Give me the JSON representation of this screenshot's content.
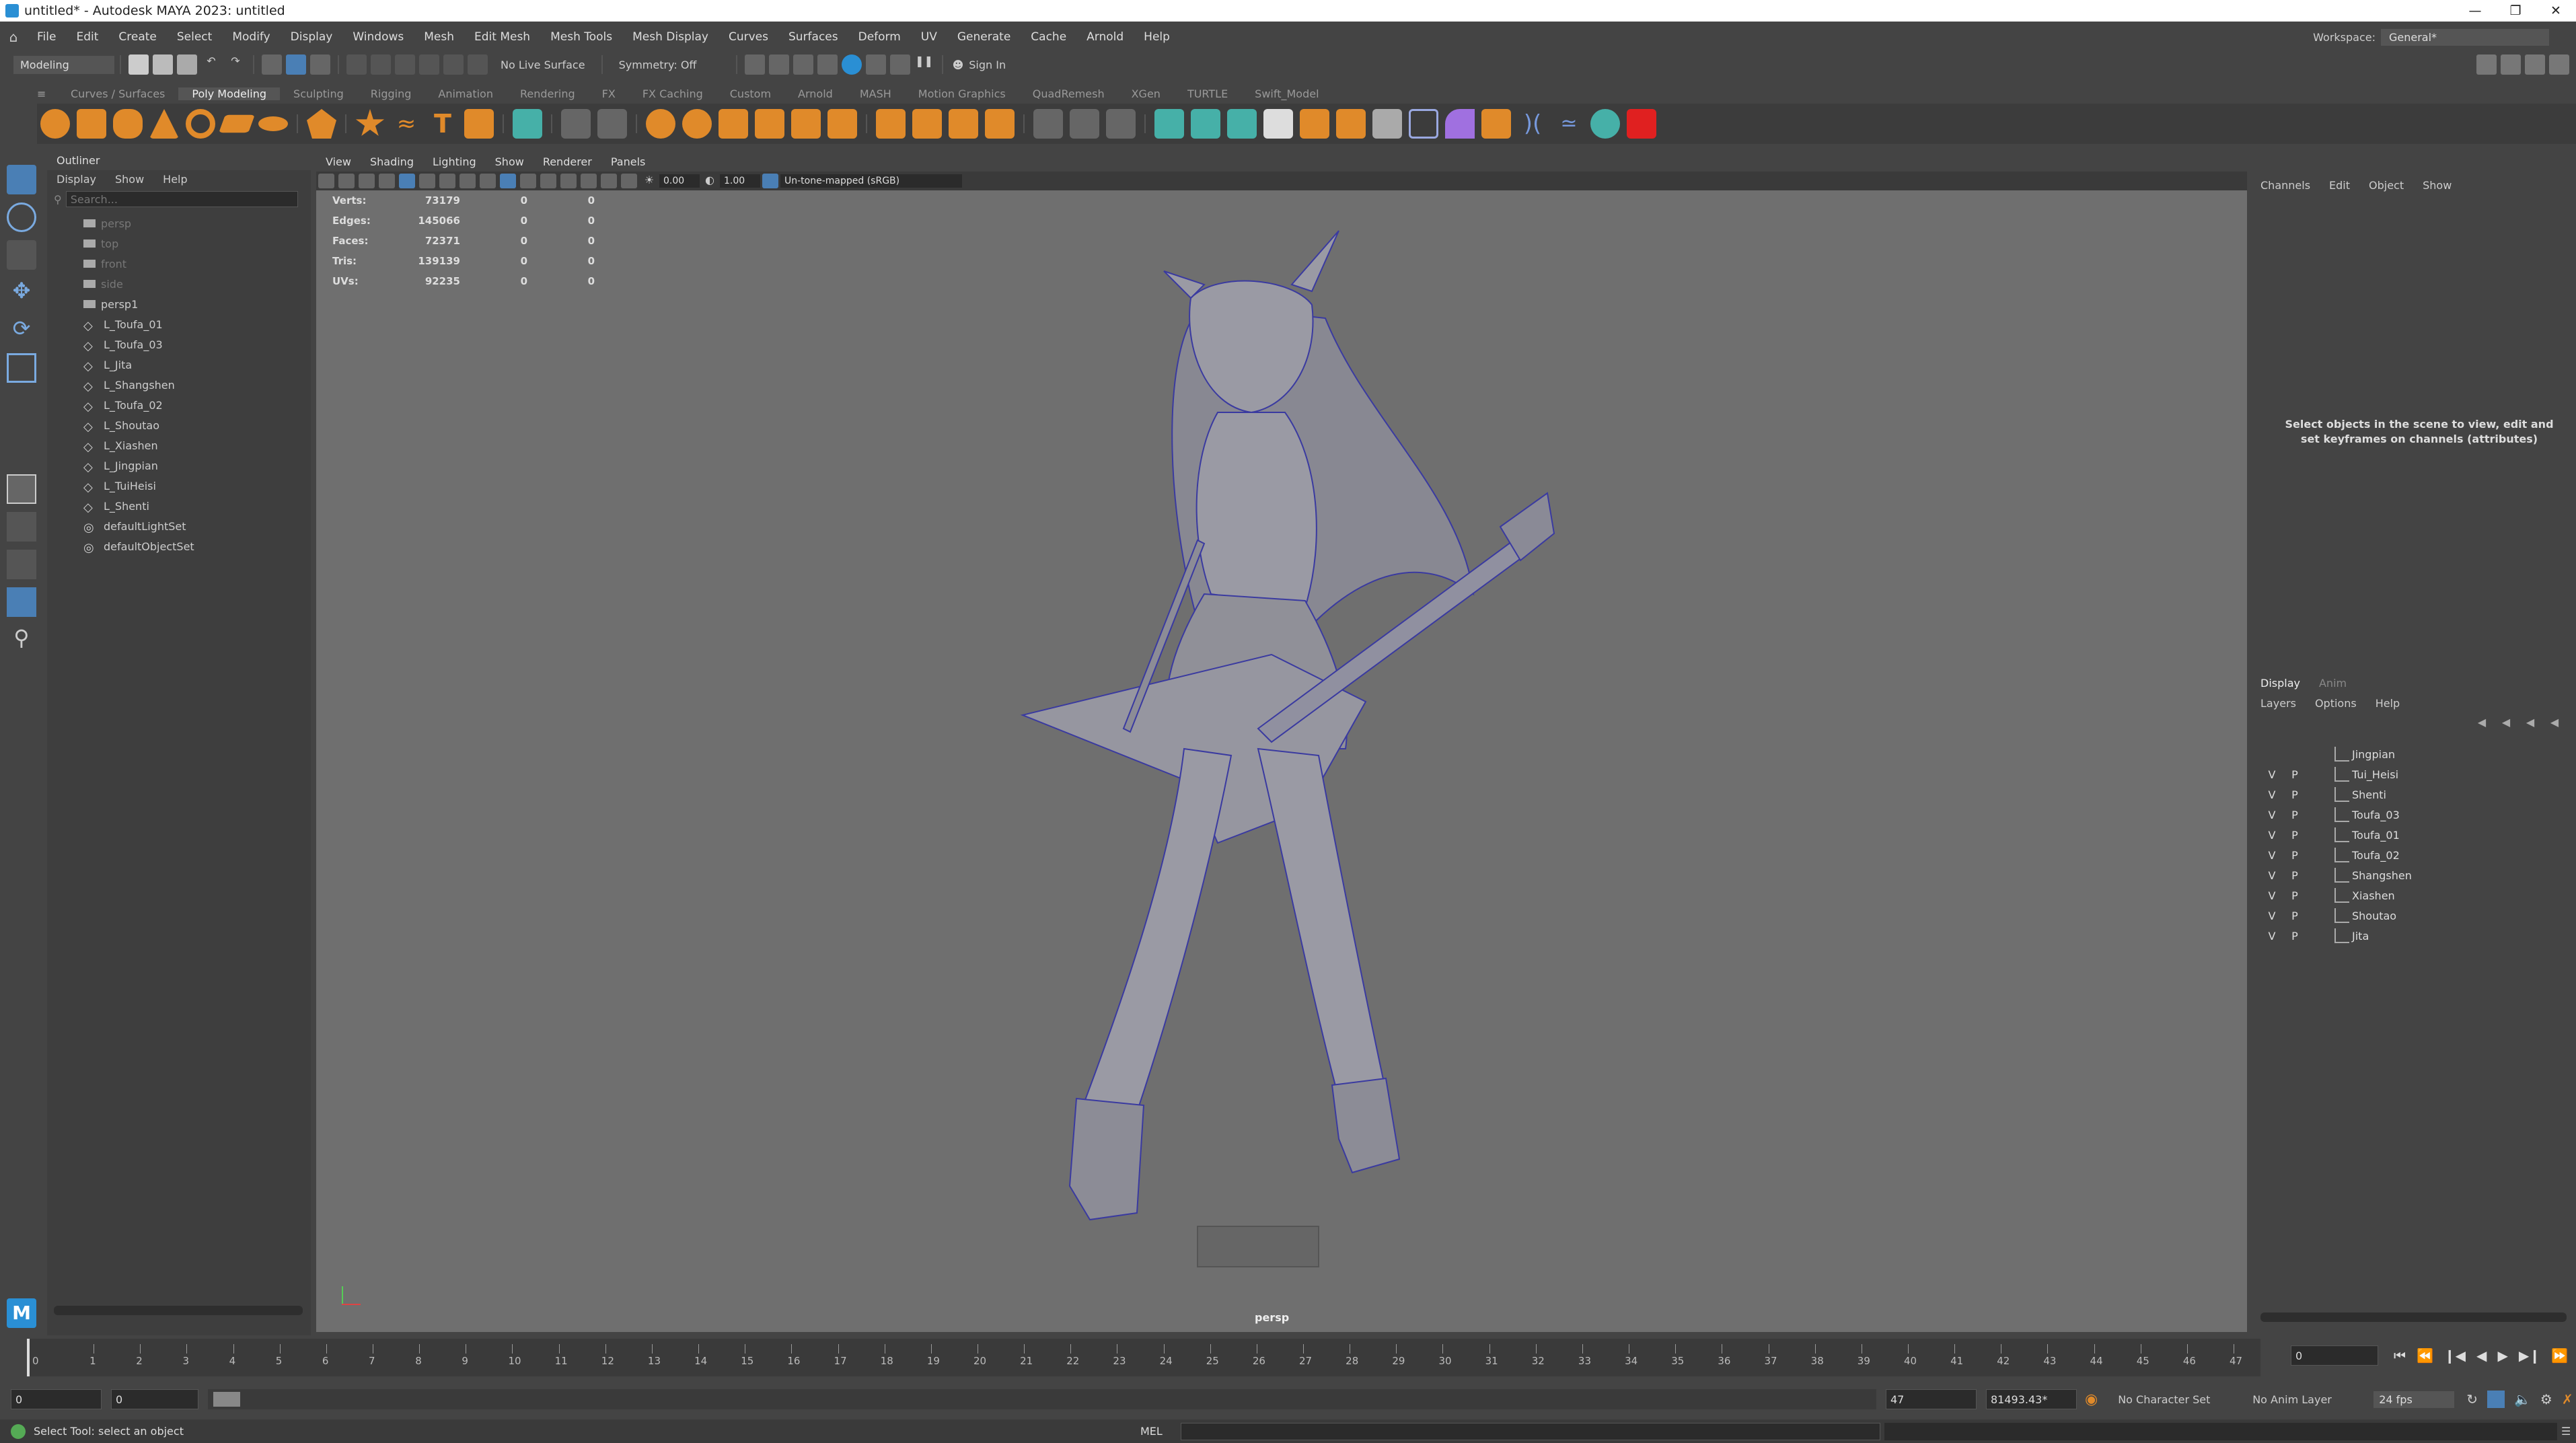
{
  "window": {
    "title": "untitled* - Autodesk MAYA 2023: untitled"
  },
  "menu": [
    "File",
    "Edit",
    "Create",
    "Select",
    "Modify",
    "Display",
    "Windows",
    "Mesh",
    "Edit Mesh",
    "Mesh Tools",
    "Mesh Display",
    "Curves",
    "Surfaces",
    "Deform",
    "UV",
    "Generate",
    "Cache",
    "Arnold",
    "Help"
  ],
  "workspace": {
    "label": "Workspace:",
    "value": "General*"
  },
  "statusline": {
    "mode": "Modeling",
    "live_surface": "No Live Surface",
    "symmetry": "Symmetry: Off",
    "sign_in": "Sign In"
  },
  "shelf_tabs": [
    "Curves / Surfaces",
    "Poly Modeling",
    "Sculpting",
    "Rigging",
    "Animation",
    "Rendering",
    "FX",
    "FX Caching",
    "Custom",
    "Arnold",
    "MASH",
    "Motion Graphics",
    "QuadRemesh",
    "XGen",
    "TURTLE",
    "Swift_Model"
  ],
  "shelf_active": "Poly Modeling",
  "shelf_colors": {
    "orange": "#e08a2a",
    "teal": "#46b0a8",
    "red": "#e02020"
  },
  "outliner": {
    "title": "Outliner",
    "menu": [
      "Display",
      "Show",
      "Help"
    ],
    "search_placeholder": "Search...",
    "items": [
      {
        "name": "persp",
        "type": "camera",
        "dim": true
      },
      {
        "name": "top",
        "type": "camera",
        "dim": true
      },
      {
        "name": "front",
        "type": "camera",
        "dim": true
      },
      {
        "name": "side",
        "type": "camera",
        "dim": true
      },
      {
        "name": "persp1",
        "type": "camera",
        "dim": false
      },
      {
        "name": "L_Toufa_01",
        "type": "mesh",
        "dim": false
      },
      {
        "name": "L_Toufa_03",
        "type": "mesh",
        "dim": false
      },
      {
        "name": "L_Jita",
        "type": "mesh",
        "dim": false
      },
      {
        "name": "L_Shangshen",
        "type": "mesh",
        "dim": false
      },
      {
        "name": "L_Toufa_02",
        "type": "mesh",
        "dim": false
      },
      {
        "name": "L_Shoutao",
        "type": "mesh",
        "dim": false
      },
      {
        "name": "L_Xiashen",
        "type": "mesh",
        "dim": false
      },
      {
        "name": "L_Jingpian",
        "type": "mesh",
        "dim": false
      },
      {
        "name": "L_TuiHeisi",
        "type": "mesh",
        "dim": false
      },
      {
        "name": "L_Shenti",
        "type": "mesh",
        "dim": false
      },
      {
        "name": "defaultLightSet",
        "type": "set",
        "dim": false
      },
      {
        "name": "defaultObjectSet",
        "type": "set",
        "dim": false
      }
    ]
  },
  "viewport": {
    "menu": [
      "View",
      "Shading",
      "Lighting",
      "Show",
      "Renderer",
      "Panels"
    ],
    "exposure": "0.00",
    "gamma": "1.00",
    "colorspace": "Un-tone-mapped (sRGB)",
    "camera_label": "persp",
    "hud": [
      {
        "label": "Verts:",
        "a": "73179",
        "b": "0",
        "c": "0"
      },
      {
        "label": "Edges:",
        "a": "145066",
        "b": "0",
        "c": "0"
      },
      {
        "label": "Faces:",
        "a": "72371",
        "b": "0",
        "c": "0"
      },
      {
        "label": "Tris:",
        "a": "139139",
        "b": "0",
        "c": "0"
      },
      {
        "label": "UVs:",
        "a": "92235",
        "b": "0",
        "c": "0"
      }
    ],
    "wire_color": "#3a3aa0"
  },
  "channelbox": {
    "menu": [
      "Channels",
      "Edit",
      "Object",
      "Show"
    ],
    "message": "Select objects in the scene to view, edit and set keyframes on channels (attributes)"
  },
  "layers": {
    "tabs": [
      "Display",
      "Anim"
    ],
    "menu": [
      "Layers",
      "Options",
      "Help"
    ],
    "items": [
      {
        "v": "",
        "p": "",
        "name": "Jingpian"
      },
      {
        "v": "V",
        "p": "P",
        "name": "Tui_Heisi"
      },
      {
        "v": "V",
        "p": "P",
        "name": "Shenti"
      },
      {
        "v": "V",
        "p": "P",
        "name": "Toufa_03"
      },
      {
        "v": "V",
        "p": "P",
        "name": "Toufa_01"
      },
      {
        "v": "V",
        "p": "P",
        "name": "Toufa_02"
      },
      {
        "v": "V",
        "p": "P",
        "name": "Shangshen"
      },
      {
        "v": "V",
        "p": "P",
        "name": "Xiashen"
      },
      {
        "v": "V",
        "p": "P",
        "name": "Shoutao"
      },
      {
        "v": "V",
        "p": "P",
        "name": "Jita"
      }
    ]
  },
  "timeline": {
    "ticks": [
      "1",
      "2",
      "3",
      "4",
      "5",
      "6",
      "7",
      "8",
      "9",
      "10",
      "11",
      "12",
      "13",
      "14",
      "15",
      "16",
      "17",
      "18",
      "19",
      "20",
      "21",
      "22",
      "23",
      "24",
      "25",
      "26",
      "27",
      "28",
      "29",
      "30",
      "31",
      "32",
      "33",
      "34",
      "35",
      "36",
      "37",
      "38",
      "39",
      "40",
      "41",
      "42",
      "43",
      "44",
      "45",
      "46",
      "47"
    ],
    "current_frame": "0",
    "current_field": "0"
  },
  "range": {
    "start": "0",
    "start2": "0",
    "end": "47",
    "end2": "81493.43*",
    "character_set": "No Character Set",
    "anim_layer": "No Anim Layer",
    "fps": "24 fps"
  },
  "helpline": {
    "mel": "MEL",
    "message": "Select Tool: select an object"
  }
}
